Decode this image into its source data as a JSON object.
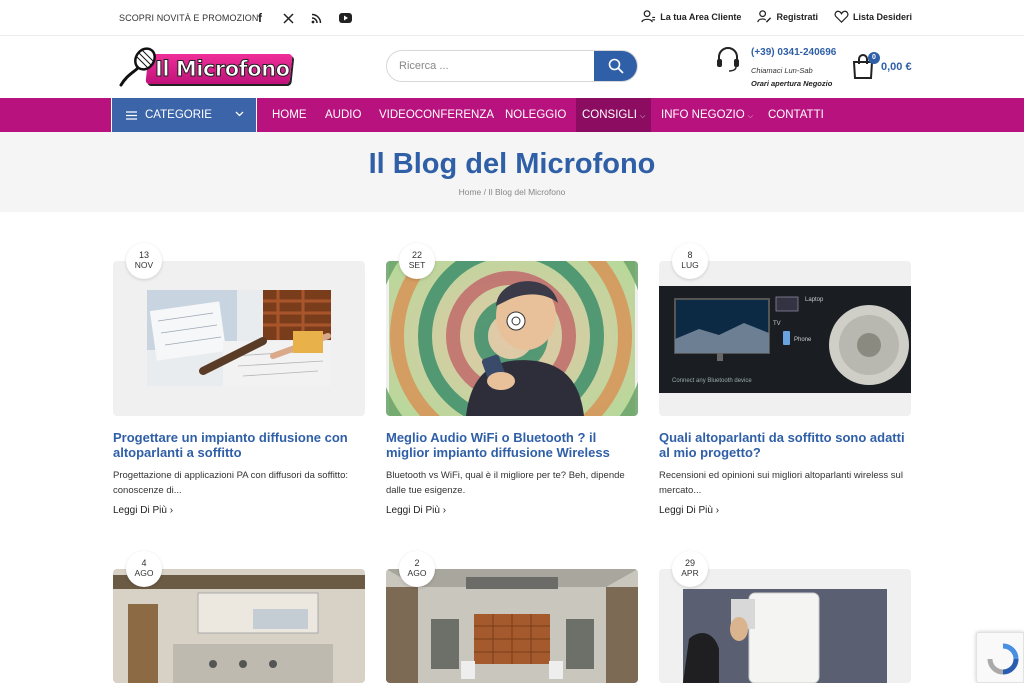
{
  "topbar": {
    "promo": "SCOPRI NOVITÀ E PROMOZIONI",
    "social": [
      "facebook-icon",
      "x-icon",
      "rss-icon",
      "youtube-icon"
    ],
    "links": {
      "account": "La tua Area Cliente",
      "register": "Registrati",
      "wishlist": "Lista Desideri"
    }
  },
  "header": {
    "logo_text": "Il Microfono",
    "search_placeholder": "Ricerca ...",
    "phone": "(+39) 0341-240696",
    "hours": "Chiamaci Lun-Sab",
    "open_hours": "Orari apertura Negozio",
    "cart_count": "0",
    "cart_amount": "0,00 €"
  },
  "nav": {
    "categories": "CATEGORIE",
    "items": [
      {
        "label": "HOME"
      },
      {
        "label": "AUDIO"
      },
      {
        "label": "VIDEOCONFERENZA"
      },
      {
        "label": "NOLEGGIO"
      },
      {
        "label": "CONSIGLI",
        "dropdown": true,
        "active": true
      },
      {
        "label": "INFO NEGOZIO",
        "dropdown": true
      },
      {
        "label": "CONTATTI"
      }
    ]
  },
  "page": {
    "title": "Il Blog del Microfono",
    "breadcrumb": [
      "Home",
      "Il Blog del Microfono"
    ]
  },
  "posts": [
    {
      "day": "13",
      "month": "NOV",
      "title": "Progettare un impianto diffusione con altoparlanti a soffitto",
      "excerpt": "Progettazione di applicazioni PA con diffusori da soffitto: conoscenze di...",
      "more": "Leggi Di Più"
    },
    {
      "day": "22",
      "month": "SET",
      "title": "Meglio Audio WiFi o Bluetooth ? il miglior impianto diffusione Wireless",
      "excerpt": "Bluetooth vs WiFi, qual è il migliore per te? Beh, dipende dalle tue esigenze.",
      "more": "Leggi Di Più"
    },
    {
      "day": "8",
      "month": "LUG",
      "title": "Quali altoparlanti da soffitto sono adatti al mio progetto?",
      "excerpt": "Recensioni ed opinioni sui migliori altoparlanti wireless sul mercato...",
      "more": "Leggi Di Più"
    },
    {
      "day": "4",
      "month": "AGO"
    },
    {
      "day": "2",
      "month": "AGO"
    },
    {
      "day": "29",
      "month": "APR"
    }
  ],
  "image_texts": {
    "laptop": "Laptop",
    "tv": "TV",
    "phone": "Phone",
    "connect": "Connect any Bluetooth device"
  },
  "colors": {
    "brand_blue": "#2f5fa7",
    "nav_magenta": "#b8127f",
    "nav_active": "#8c0c61",
    "category_blue": "#3b64a9"
  }
}
